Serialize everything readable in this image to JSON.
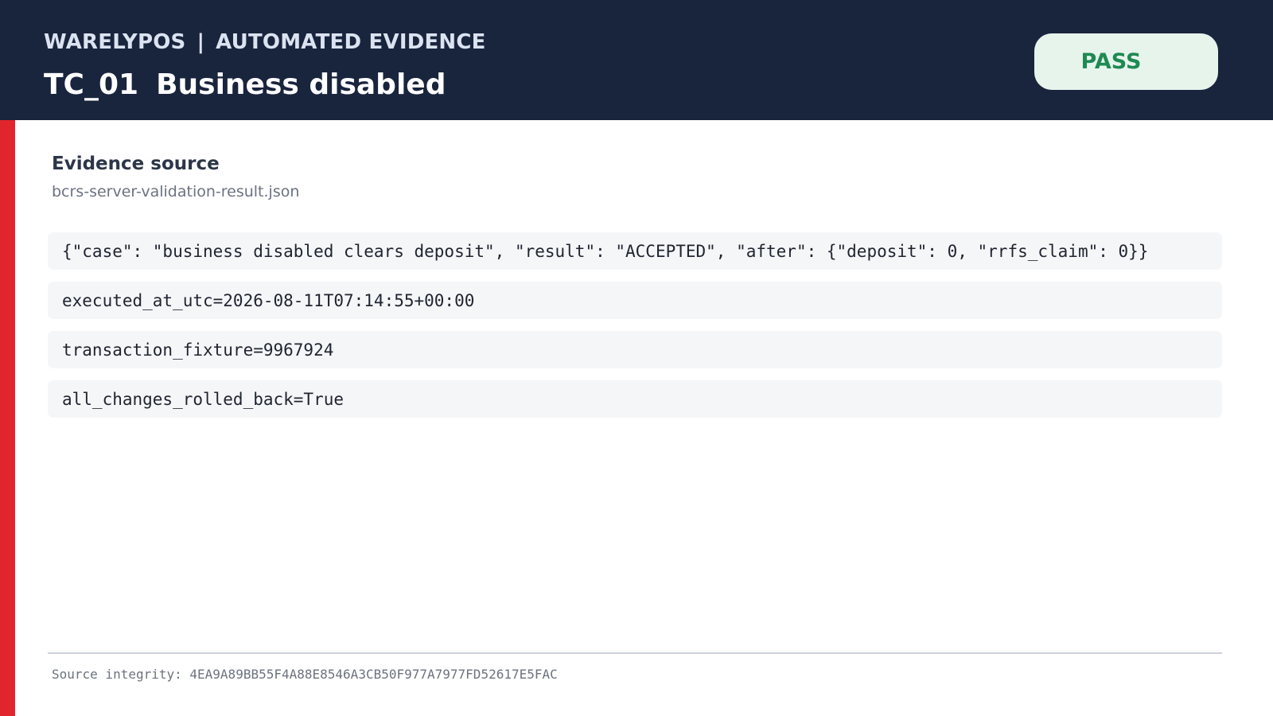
{
  "header": {
    "brand": "WARELYPOS",
    "separator": "|",
    "category": "AUTOMATED EVIDENCE",
    "case_id": "TC_01",
    "case_name": "Business disabled",
    "status": "PASS"
  },
  "colors": {
    "header_bg": "#19243d",
    "accent_bar": "#e0252c",
    "pass_bg": "#e7f4ec",
    "pass_text": "#1e8a52"
  },
  "evidence": {
    "heading": "Evidence source",
    "source_file": "bcrs-server-validation-result.json",
    "lines": [
      "{\"case\": \"business disabled clears deposit\", \"result\": \"ACCEPTED\", \"after\": {\"deposit\": 0, \"rrfs_claim\": 0}}",
      "executed_at_utc=2026-08-11T07:14:55+00:00",
      "transaction_fixture=9967924",
      "all_changes_rolled_back=True"
    ]
  },
  "footer": {
    "integrity": "Source integrity: 4EA9A89BB55F4A88E8546A3CB50F977A7977FD52617E5FAC"
  }
}
